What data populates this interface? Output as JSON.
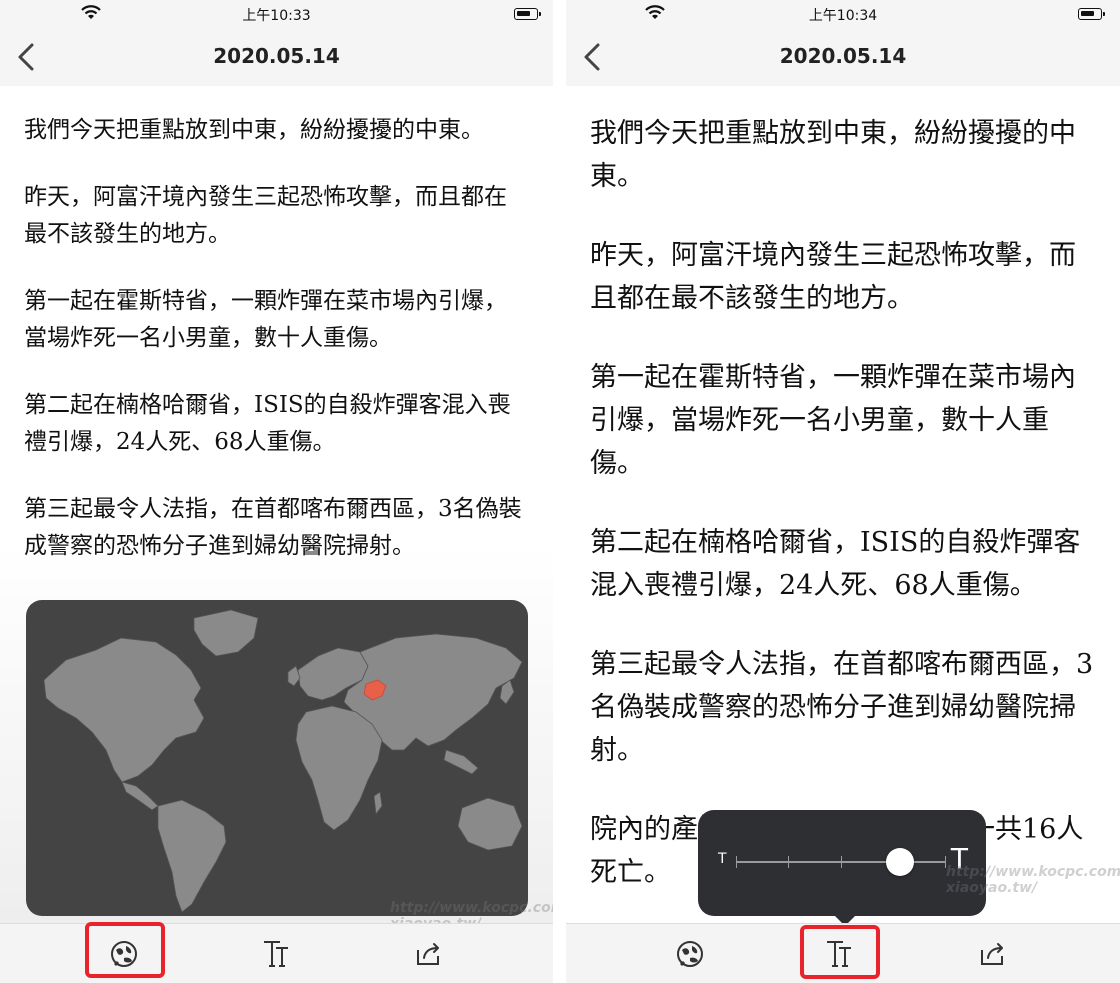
{
  "left": {
    "status": {
      "time": "上午10:33"
    },
    "nav": {
      "title": "2020.05.14"
    },
    "paragraphs": [
      "我們今天把重點放到中東，紛紛擾擾的中東。",
      "昨天，阿富汗境內發生三起恐怖攻擊，而且都在最不該發生的地方。",
      "第一起在霍斯特省，一顆炸彈在菜市場內引爆，當場炸死一名小男童，數十人重傷。",
      "第二起在楠格哈爾省，ISIS的自殺炸彈客混入喪禮引爆，24人死、68人重傷。",
      "第三起最令人法指，在首都喀布爾西區，3名偽裝成警察的恐怖分子進到婦幼醫院掃射。"
    ],
    "map_popup": {
      "highlighted_region": "Afghanistan",
      "highlight_color": "#e8604a"
    },
    "toolbar": {
      "active_tool": "map-icon"
    }
  },
  "right": {
    "status": {
      "time": "上午10:34"
    },
    "nav": {
      "title": "2020.05.14"
    },
    "paragraphs": [
      "我們今天把重點放到中東，紛紛擾擾的中東。",
      "昨天，阿富汗境內發生三起恐怖攻擊，而且都在最不該發生的地方。",
      "第一起在霍斯特省，一顆炸彈在菜市場內引爆，當場炸死一名小男童，數十人重傷。",
      "第二起在楠格哈爾省，ISIS的自殺炸彈客混入喪禮引爆，24人死、68人重傷。",
      "第三起最令人法指，在首都喀布爾西區，3名偽裝成警察的恐怖分子進到婦幼醫院掃射。",
      "院內的產婦、醫師、護理師……一共16人死亡。"
    ],
    "font_size_popup": {
      "small_label": "T",
      "large_label": "T",
      "level": 0.78
    },
    "toolbar": {
      "active_tool": "text-size-icon"
    }
  },
  "watermark": "http://www.kocpc.com.tw/ xiaoyao.tw/",
  "colors": {
    "highlight_box": "#e8232c",
    "popup_bg": "#2e2f33",
    "map_bg": "#444444",
    "land": "#8a8a8a"
  }
}
